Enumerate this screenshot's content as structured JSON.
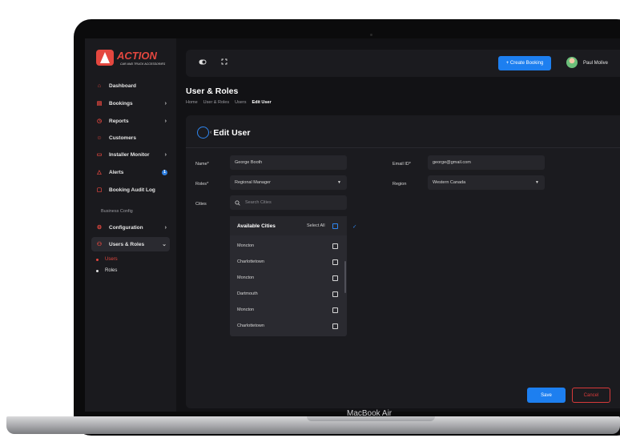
{
  "device": {
    "label": "MacBook Air"
  },
  "brand": {
    "name": "ACTION",
    "tagline": "CAR AND TRUCK ACCESSORIES",
    "accent": "#e4473f"
  },
  "sidebar": {
    "items": [
      {
        "label": "Dashboard",
        "icon": "home-icon",
        "chevron": false
      },
      {
        "label": "Bookings",
        "icon": "calendar-icon",
        "chevron": true
      },
      {
        "label": "Reports",
        "icon": "clock-icon",
        "chevron": true
      },
      {
        "label": "Customers",
        "icon": "users-icon",
        "chevron": false
      },
      {
        "label": "Installer Monitor",
        "icon": "monitor-icon",
        "chevron": true
      },
      {
        "label": "Alerts",
        "icon": "warning-icon",
        "badge": "1"
      },
      {
        "label": "Booking Audit Log",
        "icon": "document-icon",
        "chevron": false
      }
    ],
    "section_label": "Business Config",
    "config_items": [
      {
        "label": "Configuration",
        "icon": "gear-icon",
        "chevron": true
      },
      {
        "label": "Users & Roles",
        "icon": "user-roles-icon",
        "chevron_down": true
      }
    ],
    "sub_items": [
      {
        "label": "Users",
        "active": true
      },
      {
        "label": "Roles",
        "active": false
      }
    ]
  },
  "topbar": {
    "toggle_icon": "toggle-icon",
    "fullscreen_icon": "fullscreen-icon",
    "create_label": "+ Create Booking",
    "user_name": "Paul Molive"
  },
  "page": {
    "title": "User & Roles",
    "breadcrumb": [
      "Home",
      "User & Roles",
      "Users",
      "Edit User"
    ]
  },
  "form": {
    "heading": "Edit User",
    "name_label": "Name",
    "name_value": "George Booth",
    "email_label": "Email ID",
    "email_value": "george@gmail.com",
    "roles_label": "Roles",
    "roles_value": "Regional Manager",
    "region_label": "Region",
    "region_value": "Western Canada",
    "cities_label": "Cities",
    "cities_placeholder": "Search Cities",
    "required_mark": "*"
  },
  "cities_dropdown": {
    "title": "Available Cities",
    "select_all": "Select All",
    "options": [
      "Moncton",
      "Charlottetown",
      "Moncton",
      "Dartmouth",
      "Moncton",
      "Charlottetown"
    ]
  },
  "actions": {
    "save": "Save",
    "cancel": "Cancel"
  },
  "colors": {
    "primary": "#1d7ff0",
    "danger": "#d83a3a",
    "bg": "#121215"
  }
}
